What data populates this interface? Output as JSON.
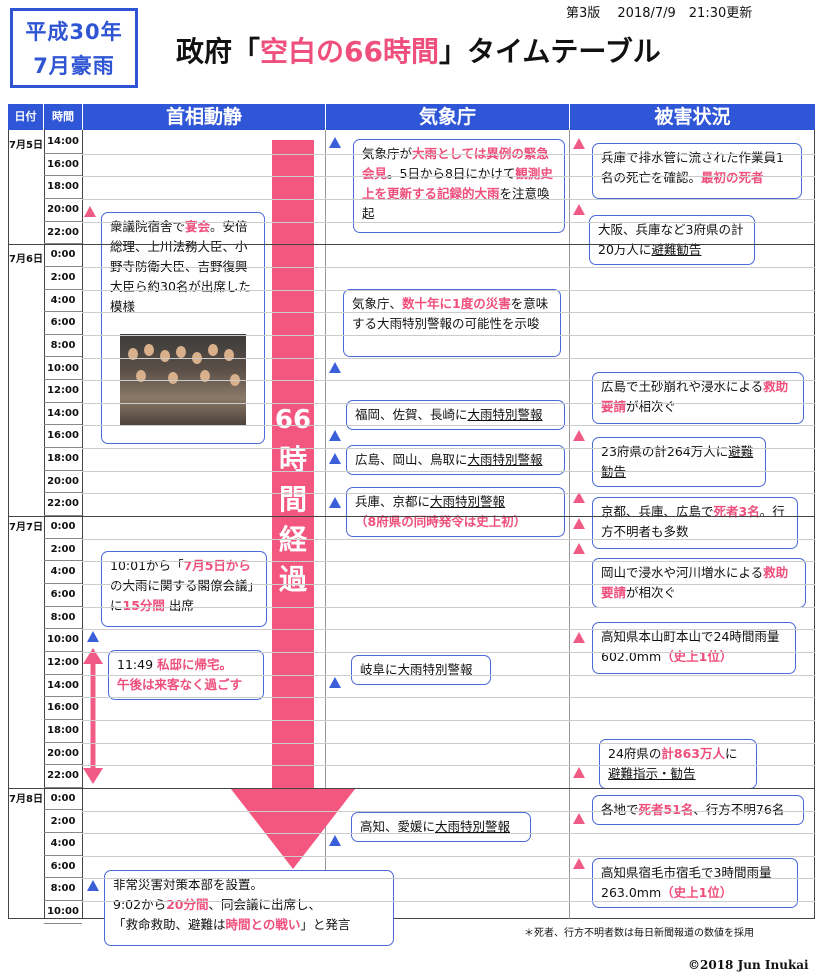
{
  "badge": {
    "line1": "平成30年",
    "line2": "7月豪雨"
  },
  "version": "第3版　 2018/7/9　21:30更新",
  "title": {
    "prefix": "政府「",
    "highlight": "空白の66時間",
    "suffix": "」タイムテーブル"
  },
  "headers": {
    "date": "日付",
    "time": "時間",
    "pm": "首相動静",
    "jma": "気象庁",
    "damage": "被害状況"
  },
  "dates": [
    "7月5日",
    "7月6日",
    "7月7日",
    "7月8日"
  ],
  "times": [
    "14:00",
    "16:00",
    "18:00",
    "20:00",
    "22:00",
    "0:00",
    "2:00",
    "4:00",
    "6:00",
    "8:00",
    "10:00",
    "12:00",
    "14:00",
    "16:00",
    "18:00",
    "20:00",
    "22:00",
    "0:00",
    "2:00",
    "4:00",
    "6:00",
    "8:00",
    "10:00",
    "12:00",
    "14:00",
    "16:00",
    "18:00",
    "20:00",
    "22:00",
    "0:00",
    "2:00",
    "4:00",
    "6:00",
    "8:00",
    "10:00"
  ],
  "big_arrow": [
    "66",
    "時",
    "間",
    "経",
    "過"
  ],
  "pm": {
    "b1": {
      "pre": "衆議院宿舎で",
      "hl": "宴会",
      "post": "。安倍総理、上川法務大臣、小野寺防衛大臣、吉野復興大臣ら約30名が出席した模様"
    },
    "b2": {
      "a": "10:01から「",
      "b": "7月5日から",
      "c": "の大雨に関する閣僚会議」に",
      "d": "15分間",
      "e": " 出席"
    },
    "b3": {
      "a": "11:49 ",
      "b": "私邸に帰宅。",
      "c": "午後は来客なく過ごす"
    },
    "b4": {
      "a": "非常災害対策本部を設置。",
      "b": "9:02から",
      "c": "20分間",
      "d": "、同会議に出席し、",
      "e": "「救命救助、避難は",
      "f": "時間との戦い",
      "g": "」と発言"
    }
  },
  "jma": {
    "b1": {
      "a": "気象庁が",
      "b": "大雨としては異例の緊急会見",
      "c": "。5日から8日にかけて",
      "d": "観測史上を更新する記録的大雨",
      "e": "を注意喚起"
    },
    "b2": {
      "a": "気象庁、",
      "b": "数十年に1度の災害",
      "c": "を意味する大雨特別警報の可能性を示唆"
    },
    "b3": {
      "a": "福岡、佐賀、長崎に",
      "b": "大雨特別警報"
    },
    "b4": {
      "a": "広島、岡山、鳥取に",
      "b": "大雨特別警報"
    },
    "b5": {
      "a": "兵庫、京都に",
      "b": "大雨特別警報",
      "c": "（8府県の同時発令は史上初）"
    },
    "b6": {
      "a": "岐阜に",
      "b": "大雨特別警報"
    },
    "b7": {
      "a": "高知、愛媛に",
      "b": "大雨特別警報"
    }
  },
  "damage": {
    "b1": {
      "a": "兵庫で排水管に流された作業員1名の死亡を確認。",
      "b": "最初の死者"
    },
    "b2": {
      "a": "大阪、兵庫など3府県の計20万人に",
      "b": "避難勧告"
    },
    "b3": {
      "a": "広島で土砂崩れや浸水による",
      "b": "救助要請",
      "c": "が相次ぐ"
    },
    "b4": {
      "a": "23府県の計264万人に",
      "b": "避難勧告"
    },
    "b5": {
      "a": "京都、兵庫、広島で",
      "b": "死者3名",
      "c": "。行方不明者も多数"
    },
    "b6": {
      "a": "岡山で浸水や河川増水による",
      "b": "救助要請",
      "c": "が相次ぐ"
    },
    "b7": {
      "a": "高知県本山町本山で24時間雨量602.0mm",
      "b": "（史上1位）"
    },
    "b8": {
      "a": "24府県の",
      "b": "計863万人",
      "c": "に",
      "d": "避難指示・勧告"
    },
    "b9": {
      "a": "各地で",
      "b": "死者51名",
      "c": "、行方不明76名"
    },
    "b10": {
      "a": "高知県宿毛市宿毛で3時間雨量263.0mm",
      "b": "（史上1位）"
    }
  },
  "footnote": "＊死者、行方不明者数は毎日新聞報道の数値を採用",
  "copyright": "©2018 Jun Inukai",
  "colors": {
    "accent_blue": "#2f56d6",
    "accent_pink": "#ef4f7c"
  }
}
